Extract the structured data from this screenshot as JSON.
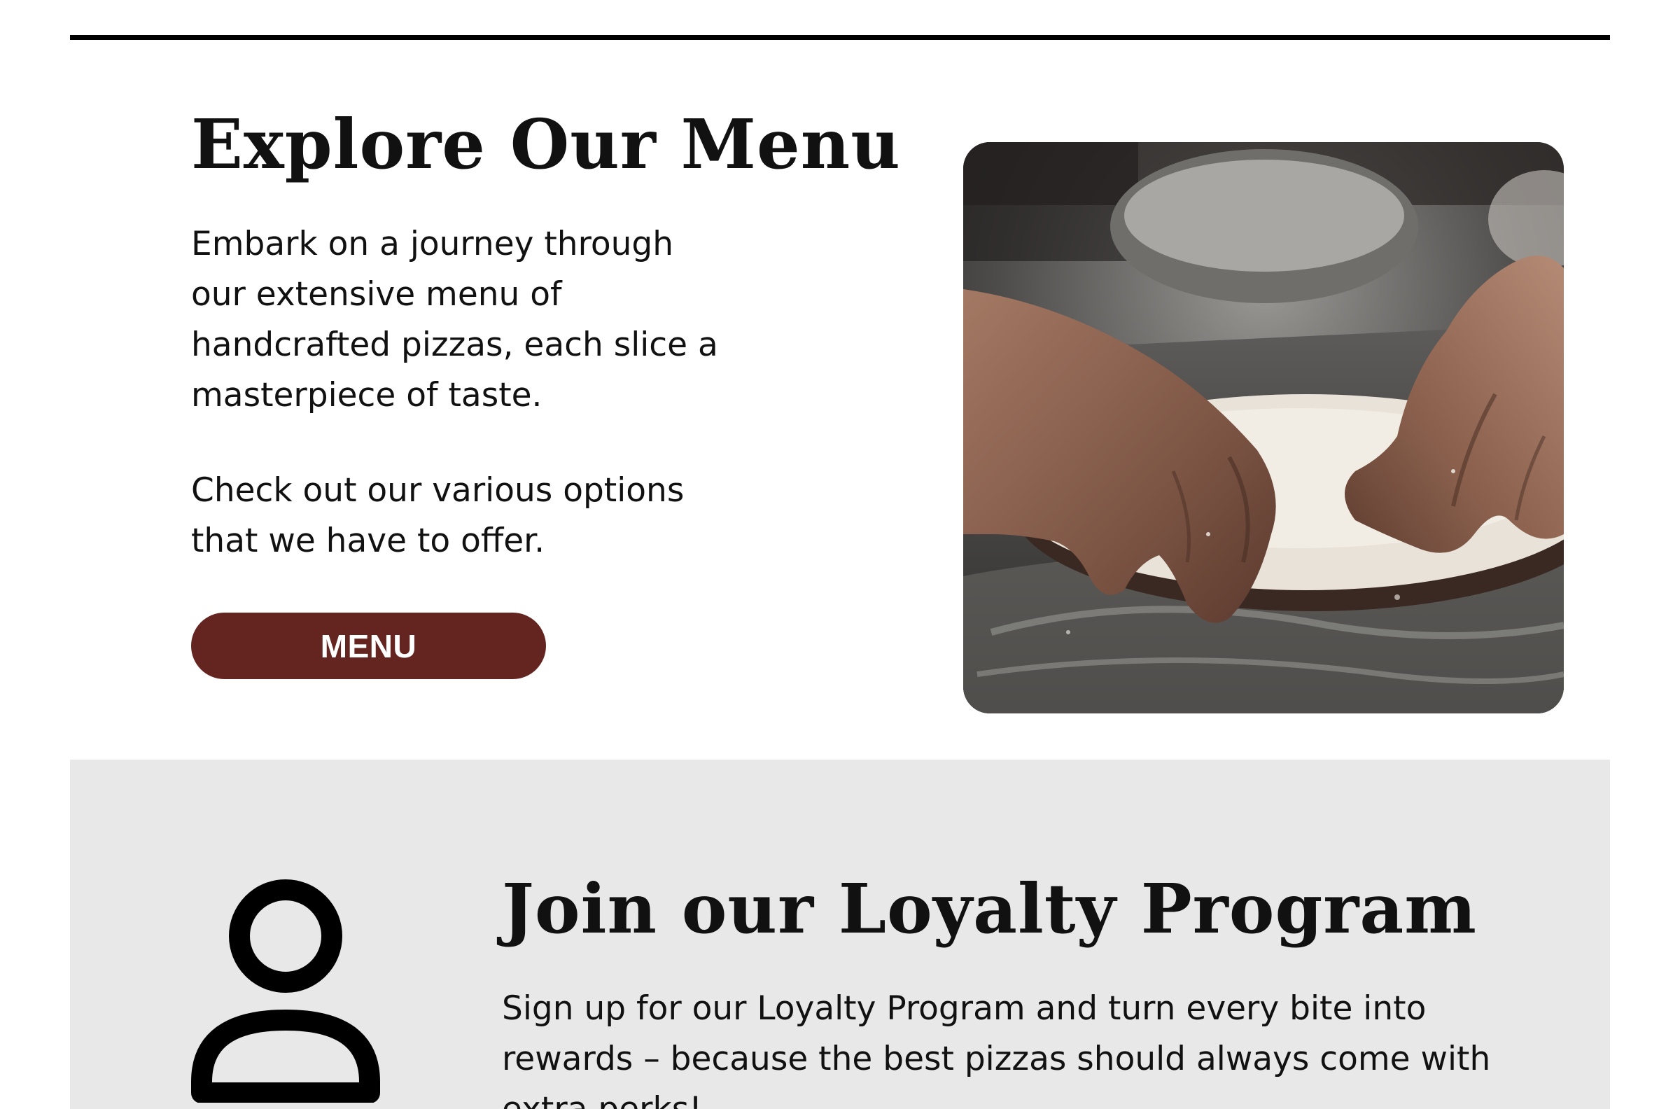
{
  "menu_section": {
    "title": "Explore Our Menu",
    "paragraph_1": "Embark on a journey through our extensive menu of handcrafted pizzas, each slice a masterpiece of taste.",
    "paragraph_2": "Check out our various options that we have to offer.",
    "button_label": "MENU",
    "button_color": "#642520",
    "image_icon": "pizza-dough-hands-photo"
  },
  "loyalty_section": {
    "icon": "user-icon",
    "title": "Join our Loyalty Program",
    "description": "Sign up for our Loyalty Program and turn every bite into rewards – because the best pizzas should always come with extra perks!",
    "background_color": "#e8e8e8"
  }
}
